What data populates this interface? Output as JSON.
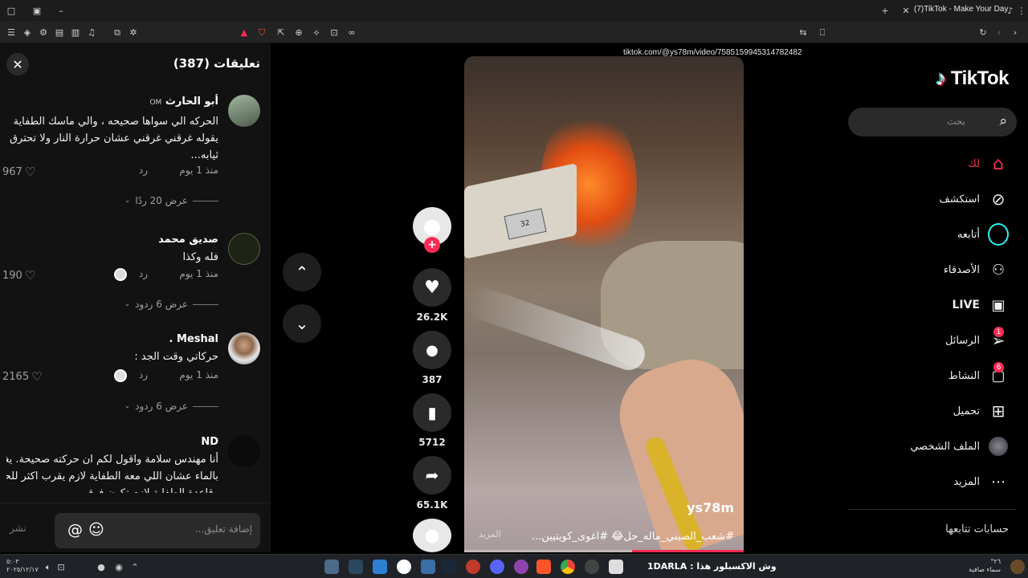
{
  "browser": {
    "tab_title": "(7)TikTok - Make Your Day",
    "url": "tiktok.com/@ys78m/video/7585159945314782482"
  },
  "comments": {
    "title": "تعليقات (387)",
    "items": [
      {
        "name": "أبو الحارث",
        "suffix": "OM",
        "text": "الحركه الي سواها صحيحه ، والي ماسك الطفاية يقوله غرقني غرقني عشان حرارة النار ولا تحترق ثيابه...",
        "time": "منذ 1 يوم",
        "reply": "رد",
        "likes": "967",
        "view_replies": "عرض 20 ردًا"
      },
      {
        "name": "صديق محمد",
        "suffix": "",
        "text": "فله وكذا",
        "time": "منذ 1 يوم",
        "reply": "رد",
        "likes": "190",
        "view_replies": "عرض 6 ردود"
      },
      {
        "name": "Meshal .",
        "suffix": "",
        "text": "حركاتي وقت الجد :",
        "time": "منذ 1 يوم",
        "reply": "رد",
        "likes": "2165",
        "view_replies": "عرض 6 ردود"
      },
      {
        "name": "ND",
        "suffix": "",
        "text": "أنا مهندس سلامة واقول لكم ان حركته صحيحة. يغرقه بالماء عشان اللي معه الطفاية لازم يقرب اكثر للحريق وقاعدة الطفاية لازم تكون فوق",
        "time": "",
        "reply": "",
        "likes": "",
        "view_replies": ""
      }
    ],
    "input_placeholder": "إضافة تعليق...",
    "post_label": "نشر"
  },
  "video": {
    "author": "ys78m",
    "caption": "#شعب_الصيني_ماله_حل😂 #اغوى_كويتيين...",
    "more_label": "المزيد",
    "plate_text": "32",
    "progress": 0.4
  },
  "actions": {
    "likes": "26.2K",
    "comments": "387",
    "saves": "5712",
    "shares": "65.1K"
  },
  "sidebar": {
    "logo": "TikTok",
    "search_placeholder": "بحث",
    "items": [
      {
        "label": "لك",
        "icon": "home-icon",
        "active": true
      },
      {
        "label": "استكشف",
        "icon": "compass-icon"
      },
      {
        "label": "أتابعه",
        "icon": "following-icon"
      },
      {
        "label": "الأصدقاء",
        "icon": "friends-icon"
      },
      {
        "label": "LIVE",
        "icon": "live-icon"
      },
      {
        "label": "الرسائل",
        "icon": "messages-icon",
        "badge": "1"
      },
      {
        "label": "النشاط",
        "icon": "activity-icon",
        "badge": "6"
      },
      {
        "label": "تحميل",
        "icon": "upload-icon"
      },
      {
        "label": "الملف الشخصي",
        "icon": "profile-icon"
      },
      {
        "label": "المزيد",
        "icon": "more-icon"
      }
    ],
    "following_title": "حسابات تتابعها"
  },
  "taskbar": {
    "news": "وش الاكسبلور هذا : 1DARLA",
    "weather_temp": "°٢٦",
    "weather_text": "سماء صافية",
    "time": "٥:٠٣",
    "date": "٢٠٢٥/١٢/١٧"
  },
  "colors": {
    "accent": "#fe2c55",
    "cyan": "#25f4ee",
    "panel": "#121212"
  }
}
